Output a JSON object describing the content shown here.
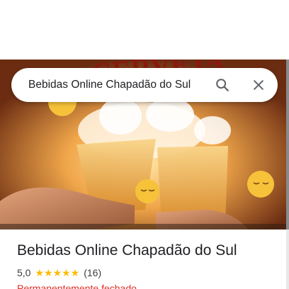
{
  "search": {
    "query": "Bebidas Online Chapadão do Sul",
    "search_icon": "search-icon",
    "close_icon": "close-icon"
  },
  "hero": {
    "alt": "beer-glasses-toast-photo",
    "banner_text": "CERVEJA"
  },
  "place": {
    "title": "Bebidas Online Chapadão do Sul",
    "rating": "5,0",
    "stars": "★★★★★",
    "review_count": "(16)",
    "status": "Permanentemente fechado"
  },
  "colors": {
    "star": "#fbbc04",
    "closed_status": "#d93025",
    "title": "#202124"
  }
}
